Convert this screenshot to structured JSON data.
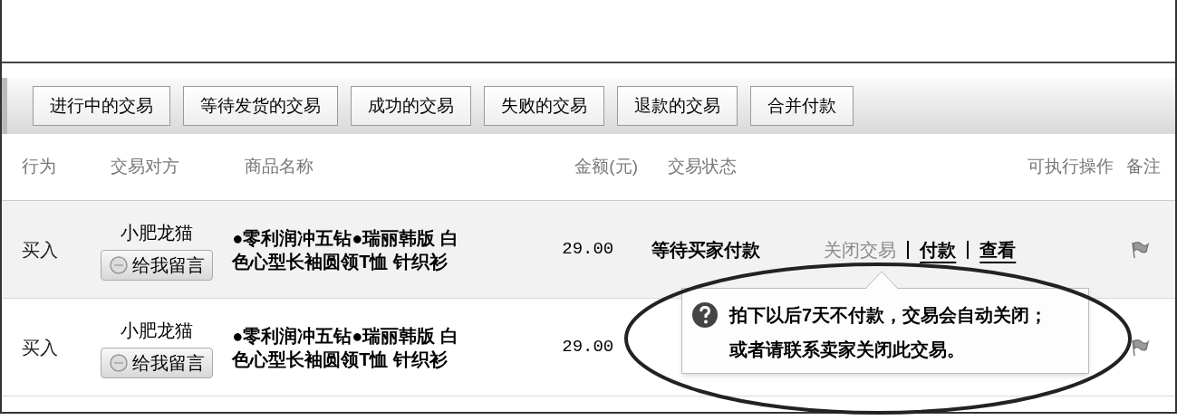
{
  "tabs": [
    {
      "label": "进行中的交易"
    },
    {
      "label": "等待发货的交易"
    },
    {
      "label": "成功的交易"
    },
    {
      "label": "失败的交易"
    },
    {
      "label": "退款的交易"
    },
    {
      "label": "合并付款"
    }
  ],
  "columns": [
    "行为",
    "交易对方",
    "商品名称",
    "金额(元)",
    "交易状态",
    "可执行操作",
    "备注"
  ],
  "rows": [
    {
      "action": "买入",
      "counterparty": "小肥龙猫",
      "message_button": "给我留言",
      "product": "●零利润冲五钻●瑞丽韩版 白色心型长袖圆领T恤 针织衫",
      "amount": "29.00",
      "status": "等待买家付款",
      "operations": [
        {
          "label": "关闭交易",
          "disabled": true
        },
        {
          "label": "付款",
          "disabled": false
        },
        {
          "label": "查看",
          "disabled": false
        }
      ]
    },
    {
      "action": "买入",
      "counterparty": "小肥龙猫",
      "message_button": "给我留言",
      "product": "●零利润冲五钻●瑞丽韩版 白色心型长袖圆领T恤 针织衫",
      "amount": "29.00"
    }
  ],
  "tooltip": {
    "text": "拍下以后7天不付款，交易会自动关闭；或者请联系卖家关闭此交易。"
  }
}
